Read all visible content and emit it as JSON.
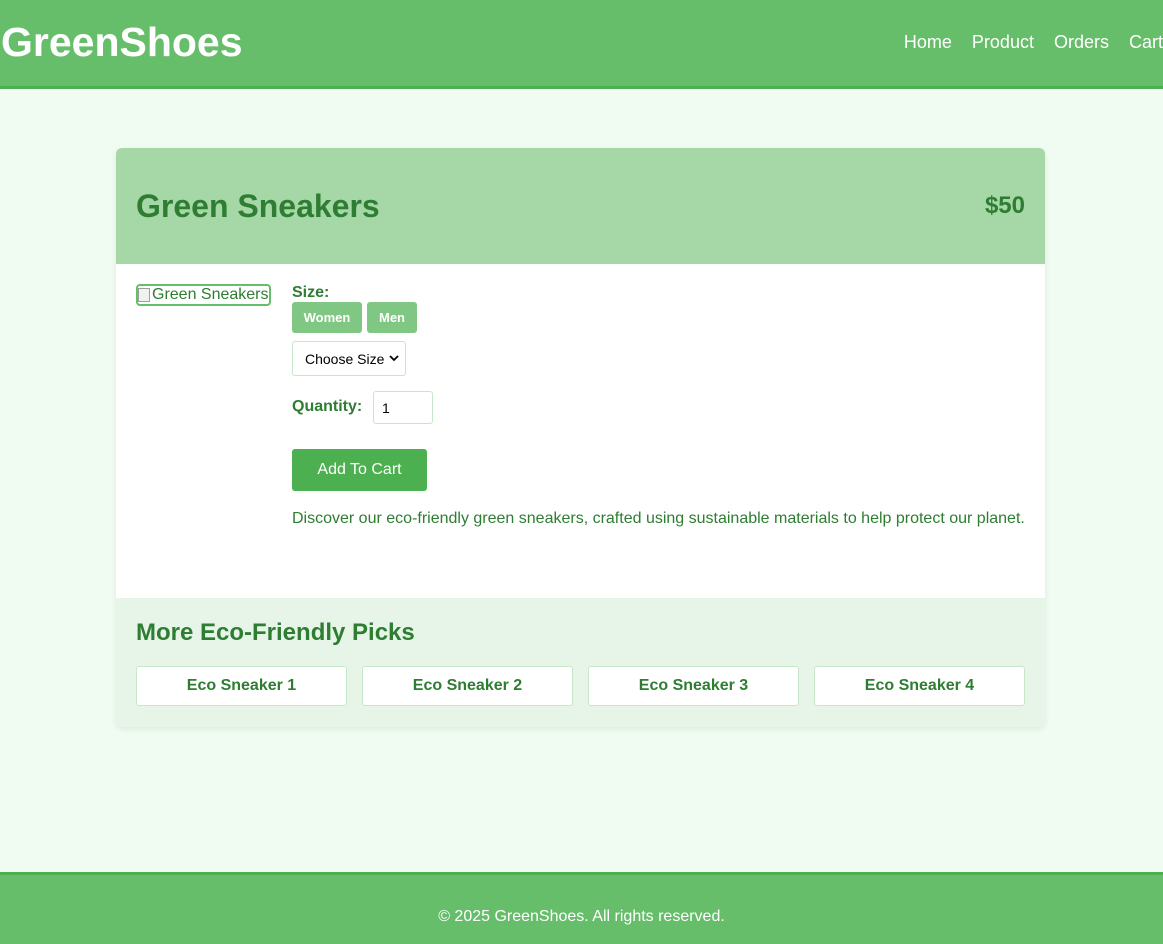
{
  "header": {
    "brand": "GreenShoes",
    "nav": [
      {
        "label": "Home"
      },
      {
        "label": "Product"
      },
      {
        "label": "Orders"
      },
      {
        "label": "Cart"
      }
    ]
  },
  "product": {
    "title": "Green Sneakers",
    "price": "$50",
    "image_alt": "Green Sneakers",
    "size_label": "Size:",
    "size_groups": [
      "Women",
      "Men"
    ],
    "size_select_value": "Choose Size",
    "quantity_label": "Quantity:",
    "quantity_value": "1",
    "add_to_cart_label": "Add To Cart",
    "description": "Discover our eco-friendly green sneakers, crafted using sustainable materials to help protect our planet."
  },
  "more": {
    "title": "More Eco-Friendly Picks",
    "items": [
      {
        "label": "Eco Sneaker 1"
      },
      {
        "label": "Eco Sneaker 2"
      },
      {
        "label": "Eco Sneaker 3"
      },
      {
        "label": "Eco Sneaker 4"
      }
    ]
  },
  "footer": {
    "copyright": "© 2025 GreenShoes. All rights reserved."
  },
  "colors": {
    "header_green": "#66bd6a",
    "accent_green": "#4caf50",
    "text_green": "#2e7d32",
    "card_header": "#a5d7a7",
    "page_background": "#f0fcf2"
  },
  "icons": {
    "select_arrow": "chevron-down-icon",
    "image_placeholder": "broken-image-icon"
  }
}
